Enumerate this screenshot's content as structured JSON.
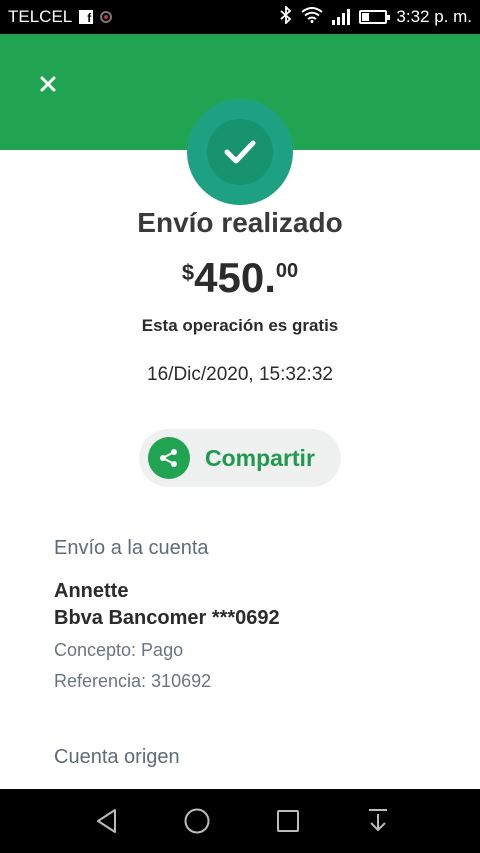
{
  "status_bar": {
    "carrier": "TELCEL",
    "time": "3:32 p. m.",
    "icons": [
      "facebook-icon",
      "record-icon",
      "bluetooth-icon",
      "wifi-icon",
      "signal-icon",
      "battery-icon"
    ],
    "battery_level": 0.3
  },
  "header": {
    "color": "#21a452",
    "close_icon": "close-icon"
  },
  "status_icon": "check-icon",
  "title": "Envío realizado",
  "amount": {
    "currency": "$",
    "integer": "450.",
    "decimal": "00"
  },
  "fee_note": "Esta operación es gratis",
  "datetime": "16/Dic/2020, 15:32:32",
  "share_button": {
    "label": "Compartir",
    "icon": "share-icon"
  },
  "destination": {
    "section_label": "Envío a la cuenta",
    "name": "Annette",
    "bank_account": "Bbva Bancomer ***0692",
    "concept": "Concepto: Pago",
    "reference": "Referencia: 310692"
  },
  "origin": {
    "section_label": "Cuenta origen"
  },
  "nav_bar": {
    "icons": [
      "back-icon",
      "home-icon",
      "recents-icon",
      "notifications-pulldown-icon"
    ]
  }
}
